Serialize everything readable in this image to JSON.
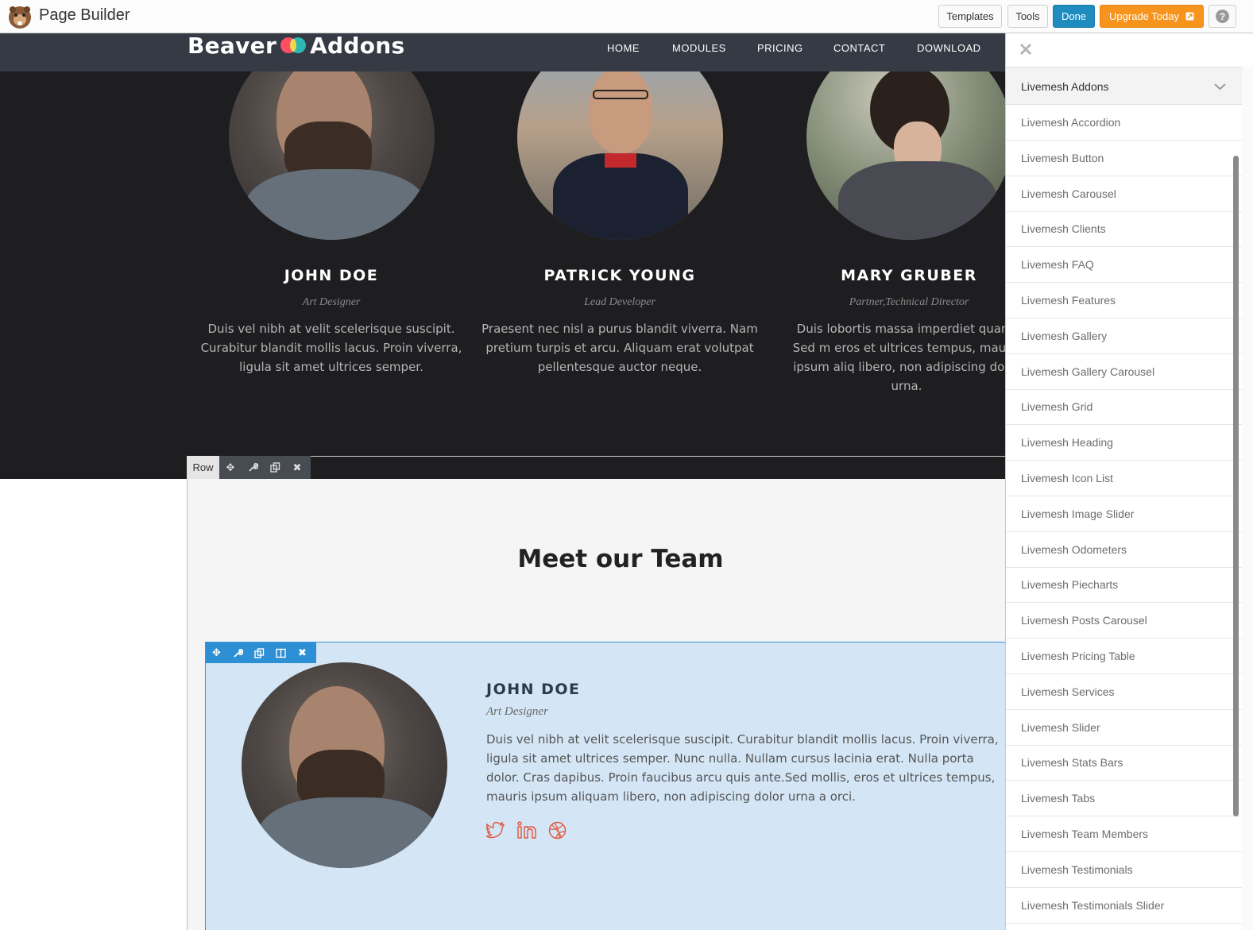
{
  "builder": {
    "title": "Page Builder",
    "buttons": {
      "templates": "Templates",
      "tools": "Tools",
      "done": "Done",
      "upgrade": "Upgrade Today",
      "help": "?"
    },
    "colors": {
      "done": "#1e8cbe",
      "upgrade": "#f7941d"
    }
  },
  "site": {
    "brand_left": "Beaver",
    "brand_right": "Addons",
    "nav": [
      "HOME",
      "MODULES",
      "PRICING",
      "CONTACT",
      "DOWNLOAD"
    ]
  },
  "team_dark": [
    {
      "name": "JOHN DOE",
      "role": "Art Designer",
      "bio": "Duis vel nibh at velit scelerisque suscipit. Curabitur blandit mollis lacus. Proin viverra, ligula sit amet ultrices semper."
    },
    {
      "name": "PATRICK YOUNG",
      "role": "Lead Developer",
      "bio": "Praesent nec nisl a purus blandit viverra. Nam pretium turpis et arcu. Aliquam erat volutpat pellentesque auctor neque."
    },
    {
      "name": "MARY GRUBER",
      "role": "Partner,Technical Director",
      "bio": "Duis lobortis massa imperdiet quam. Sed m eros et ultrices tempus, mauris ipsum aliq libero, non adipiscing dolor urna."
    }
  ],
  "row_toolbar": {
    "label": "Row"
  },
  "section": {
    "heading": "Meet our Team"
  },
  "module": {
    "name": "JOHN DOE",
    "role": "Art Designer",
    "bio": "Duis vel nibh at velit scelerisque suscipit. Curabitur blandit mollis lacus. Proin viverra, ligula sit amet ultrices semper. Nunc nulla. Nullam cursus lacinia erat. Nulla porta dolor. Cras dapibus. Proin faucibus arcu quis ante.Sed mollis, eros et ultrices tempus, mauris ipsum aliquam libero, non adipiscing dolor urna a orci.",
    "social_icons": [
      "twitter-icon",
      "linkedin-icon",
      "dribbble-icon"
    ],
    "social_color": "#e2543b"
  },
  "panel": {
    "group": "Livemesh Addons",
    "items": [
      "Livemesh Accordion",
      "Livemesh Button",
      "Livemesh Carousel",
      "Livemesh Clients",
      "Livemesh FAQ",
      "Livemesh Features",
      "Livemesh Gallery",
      "Livemesh Gallery Carousel",
      "Livemesh Grid",
      "Livemesh Heading",
      "Livemesh Icon List",
      "Livemesh Image Slider",
      "Livemesh Odometers",
      "Livemesh Piecharts",
      "Livemesh Posts Carousel",
      "Livemesh Pricing Table",
      "Livemesh Services",
      "Livemesh Slider",
      "Livemesh Stats Bars",
      "Livemesh Tabs",
      "Livemesh Team Members",
      "Livemesh Testimonials",
      "Livemesh Testimonials Slider"
    ]
  }
}
